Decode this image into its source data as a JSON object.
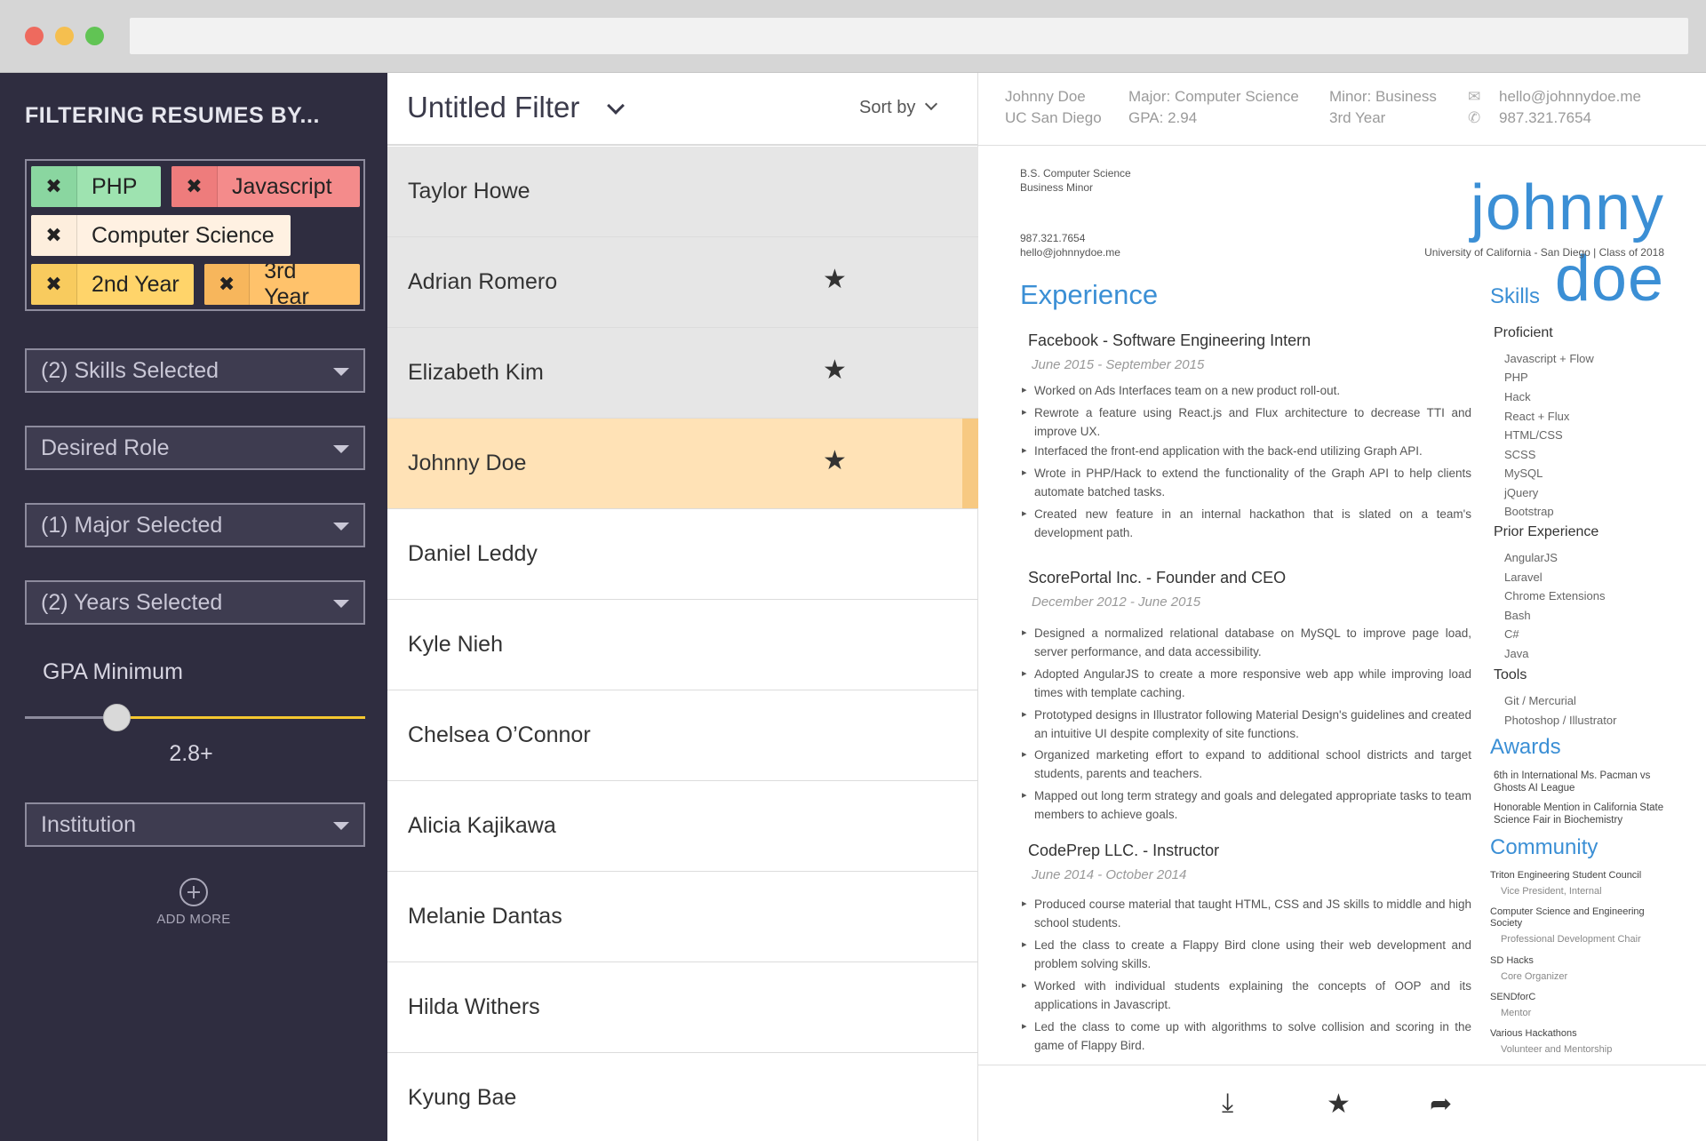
{
  "sidebar": {
    "title": "FILTERING RESUMES BY...",
    "tags": [
      {
        "label": "PHP",
        "remove": "✖"
      },
      {
        "label": "Javascript",
        "remove": "✖"
      },
      {
        "label": "Computer Science",
        "remove": "✖"
      },
      {
        "label": "2nd Year",
        "remove": "✖"
      },
      {
        "label": "3rd Year",
        "remove": "✖"
      }
    ],
    "skills_select": "(2) Skills Selected",
    "role_select": "Desired Role",
    "major_select": "(1) Major Selected",
    "years_select": "(2) Years Selected",
    "gpa_label": "GPA Minimum",
    "gpa_value": "2.8+",
    "gpa_slider_fraction": 0.27,
    "institution_select": "Institution",
    "add_more": "ADD MORE"
  },
  "list": {
    "filter_title": "Untitled Filter",
    "sort_label": "Sort by",
    "candidates": [
      {
        "name": "Taylor Howe",
        "starred": false
      },
      {
        "name": "Adrian Romero",
        "starred": true
      },
      {
        "name": "Elizabeth Kim",
        "starred": true
      },
      {
        "name": "Johnny Doe",
        "starred": true
      },
      {
        "name": "Daniel Leddy",
        "starred": false
      },
      {
        "name": "Kyle Nieh",
        "starred": false
      },
      {
        "name": "Chelsea O’Connor",
        "starred": false
      },
      {
        "name": "Alicia Kajikawa",
        "starred": false
      },
      {
        "name": "Melanie Dantas",
        "starred": false
      },
      {
        "name": "Hilda Withers",
        "starred": false
      },
      {
        "name": "Kyung Bae",
        "starred": false
      }
    ],
    "star_glyph": "★"
  },
  "resume_header": {
    "name": "Johnny Doe",
    "school": "UC San Diego",
    "major": "Major: Computer Science",
    "gpa": "GPA: 2.94",
    "minor": "Minor: Business",
    "year": "3rd Year",
    "email": "hello@johnnydoe.me",
    "phone": "987.321.7654",
    "email_icon": "✉",
    "phone_icon": "✆"
  },
  "resume": {
    "degree": "B.S. Computer Science",
    "minor": "Business Minor",
    "phone": "987.321.7654",
    "email": "hello@johnnydoe.me",
    "name": "johnny doe",
    "university": "University of California - San Diego  |  Class of 2018",
    "experience_heading": "Experience",
    "jobs": [
      {
        "title": "Facebook - Software Engineering Intern",
        "date": "June 2015 - September 2015",
        "bullets": [
          "Worked on Ads Interfaces team on a new product roll-out.",
          "Rewrote a feature using React.js and Flux architecture to decrease TTI and improve UX.",
          "Interfaced the front-end application with the back-end utilizing Graph API.",
          "Wrote in PHP/Hack to extend the functionality of the Graph API to help clients automate batched tasks.",
          "Created new feature in an internal hackathon that is slated on a team's development path."
        ]
      },
      {
        "title": "ScorePortal Inc. - Founder and CEO",
        "date": "December 2012 - June 2015",
        "bullets": [
          "Designed a normalized relational database on MySQL to improve page load, server performance, and data accessibility.",
          "Adopted AngularJS to create a more responsive web app while improving load times with template caching.",
          "Prototyped designs in Illustrator following Material Design's guidelines and created an intuitive UI despite complexity of site functions.",
          "Organized marketing effort to expand to additional school districts and target students, parents and teachers.",
          "Mapped out long term strategy and goals and delegated appropriate tasks to team members to achieve goals."
        ]
      },
      {
        "title": "CodePrep LLC. - Instructor",
        "date": "June 2014 - October 2014",
        "bullets": [
          "Produced course material that taught HTML, CSS and JS skills to middle and high school students.",
          "Led the class to create a Flappy Bird clone using their web development and problem solving skills.",
          "Worked with individual students explaining the concepts of OOP and its applications in Javascript.",
          "Led the class to come up with algorithms to solve collision and scoring in the game of Flappy Bird."
        ]
      }
    ],
    "skills_heading": "Skills",
    "proficient_label": "Proficient",
    "proficient": [
      "Javascript + Flow",
      "PHP",
      "Hack",
      "React + Flux",
      "HTML/CSS",
      "SCSS",
      "MySQL",
      "jQuery",
      "Bootstrap"
    ],
    "prior_label": "Prior Experience",
    "prior": [
      "AngularJS",
      "Laravel",
      "Chrome Extensions",
      "Bash",
      "C#",
      "Java"
    ],
    "tools_label": "Tools",
    "tools": [
      "Git / Mercurial",
      "Photoshop / Illustrator"
    ],
    "awards_heading": "Awards",
    "awards": [
      "6th in International Ms. Pacman vs Ghosts AI League",
      "Honorable Mention in California State Science Fair in Biochemistry"
    ],
    "community_heading": "Community",
    "community": [
      {
        "org": "Triton Engineering Student Council",
        "role": "Vice President, Internal"
      },
      {
        "org": "Computer Science and Engineering Society",
        "role": "Professional Development Chair"
      },
      {
        "org": "SD Hacks",
        "role": "Core Organizer"
      },
      {
        "org": "SENDforC",
        "role": "Mentor"
      },
      {
        "org": "Various Hackathons",
        "role": "Volunteer and Mentorship"
      }
    ]
  },
  "footer": {
    "download_icon": "⤓",
    "star_icon": "★",
    "share_icon": "➦"
  }
}
